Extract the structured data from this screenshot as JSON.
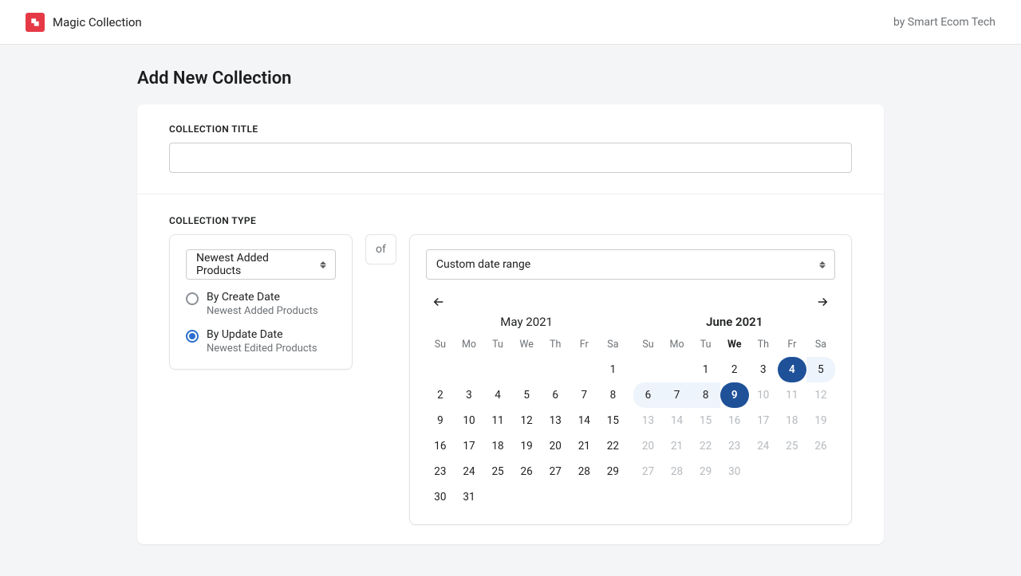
{
  "header": {
    "app_name": "Magic Collection",
    "by_text": "by Smart Ecom Tech"
  },
  "page": {
    "title": "Add New Collection"
  },
  "form": {
    "title_label": "COLLECTION TITLE",
    "title_value": "",
    "type_label": "COLLECTION TYPE",
    "of_word": "of",
    "product_filter_selected": "Newest Added Products",
    "date_mode_selected": "Custom date range",
    "radios": [
      {
        "label": "By Create Date",
        "sub": "Newest Added Products",
        "checked": false
      },
      {
        "label": "By Update Date",
        "sub": "Newest Edited Products",
        "checked": true
      }
    ]
  },
  "calendar": {
    "weekdays": [
      "Su",
      "Mo",
      "Tu",
      "We",
      "Th",
      "Fr",
      "Sa"
    ],
    "months": [
      {
        "title": "May 2021",
        "is_current": false,
        "today_col": null,
        "leading_blanks": 6,
        "range_start_day": null,
        "range_end_day": null,
        "in_range_days": [],
        "dim_after": null,
        "days": 31
      },
      {
        "title": "June 2021",
        "is_current": true,
        "today_col": 3,
        "leading_blanks": 2,
        "range_start_day": 4,
        "range_end_day": 9,
        "in_range_days": [
          5,
          6,
          7,
          8
        ],
        "dim_after": 9,
        "days": 30
      }
    ]
  }
}
